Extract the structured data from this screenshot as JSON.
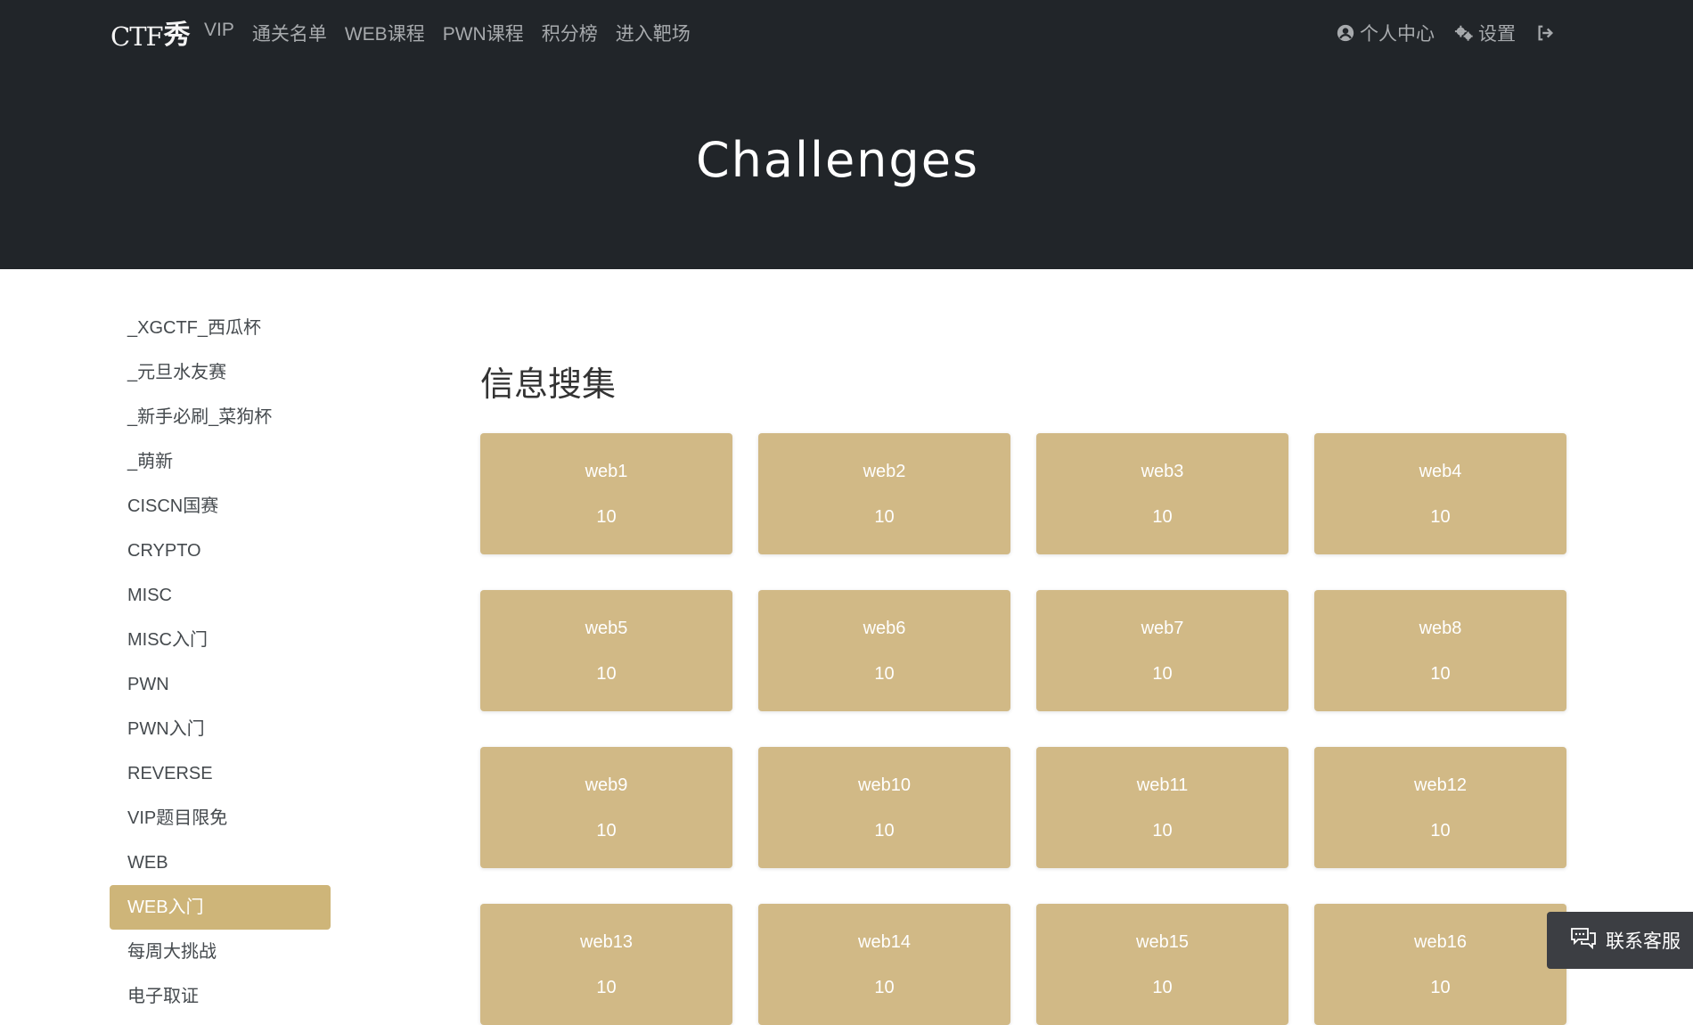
{
  "nav": {
    "logo_text": "CTF",
    "logo_mark": "秀",
    "links": [
      "VIP",
      "通关名单",
      "WEB课程",
      "PWN课程",
      "积分榜",
      "进入靶场"
    ],
    "right": {
      "profile_label": "个人中心",
      "settings_label": "设置"
    }
  },
  "hero": {
    "title": "Challenges"
  },
  "sidebar": {
    "items": [
      "_XGCTF_西瓜杯",
      "_元旦水友赛",
      "_新手必刷_菜狗杯",
      "_萌新",
      "CISCN国赛",
      "CRYPTO",
      "MISC",
      "MISC入门",
      "PWN",
      "PWN入门",
      "REVERSE",
      "VIP题目限免",
      "WEB",
      "WEB入门",
      "每周大挑战",
      "电子取证"
    ],
    "active_item": "WEB入门"
  },
  "main": {
    "section_title": "信息搜集",
    "challenges": [
      {
        "name": "web1",
        "points": "10"
      },
      {
        "name": "web2",
        "points": "10"
      },
      {
        "name": "web3",
        "points": "10"
      },
      {
        "name": "web4",
        "points": "10"
      },
      {
        "name": "web5",
        "points": "10"
      },
      {
        "name": "web6",
        "points": "10"
      },
      {
        "name": "web7",
        "points": "10"
      },
      {
        "name": "web8",
        "points": "10"
      },
      {
        "name": "web9",
        "points": "10"
      },
      {
        "name": "web10",
        "points": "10"
      },
      {
        "name": "web11",
        "points": "10"
      },
      {
        "name": "web12",
        "points": "10"
      },
      {
        "name": "web13",
        "points": "10"
      },
      {
        "name": "web14",
        "points": "10"
      },
      {
        "name": "web15",
        "points": "10"
      },
      {
        "name": "web16",
        "points": "10"
      }
    ]
  },
  "chat": {
    "label": "联系客服",
    "icon": "chat-bubbles-icon"
  },
  "colors": {
    "header_bg": "#212529",
    "accent": "#ceb579",
    "card_bg": "#d1b986",
    "chat_bg": "#3c3e43"
  }
}
